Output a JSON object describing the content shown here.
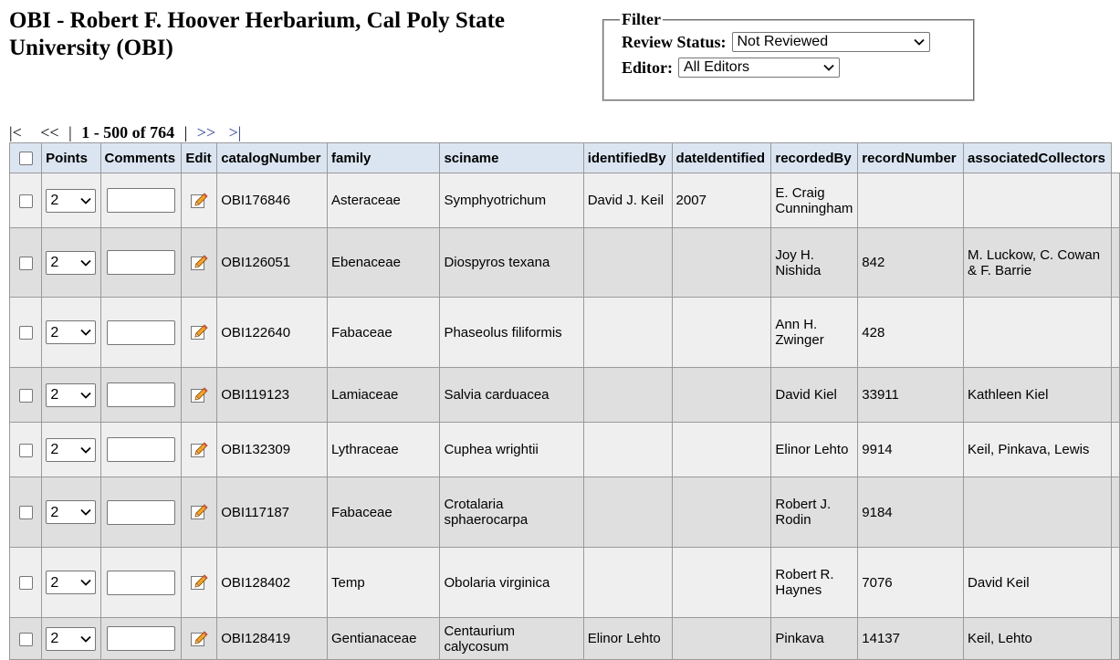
{
  "header": {
    "title": "OBI - Robert F. Hoover Herbarium, Cal Poly State University (OBI)"
  },
  "filter": {
    "legend": "Filter",
    "review_status_label": "Review Status:",
    "review_status_value": "Not Reviewed",
    "editor_label": "Editor:",
    "editor_value": "All Editors"
  },
  "pager": {
    "first": "|<",
    "prev": "<<",
    "sep": "|",
    "range": "1 - 500 of 764",
    "next": ">>",
    "last": ">|"
  },
  "table": {
    "columns": [
      "Points",
      "Comments",
      "Edit",
      "catalogNumber",
      "family",
      "sciname",
      "identifiedBy",
      "dateIdentified",
      "recordedBy",
      "recordNumber",
      "associatedCollectors"
    ],
    "rows": [
      {
        "points": "2",
        "catalogNumber": "OBI176846",
        "family": "Asteraceae",
        "sciname": "Symphyotrichum",
        "identifiedBy": "David J. Keil",
        "dateIdentified": "2007",
        "recordedBy": "E. Craig Cunningham",
        "recordNumber": "",
        "associatedCollectors": ""
      },
      {
        "points": "2",
        "catalogNumber": "OBI126051",
        "family": "Ebenaceae",
        "sciname": "Diospyros texana",
        "identifiedBy": "",
        "dateIdentified": "",
        "recordedBy": "Joy H. Nishida",
        "recordNumber": "842",
        "associatedCollectors": "M. Luckow, C. Cowan & F. Barrie"
      },
      {
        "points": "2",
        "catalogNumber": "OBI122640",
        "family": "Fabaceae",
        "sciname": "Phaseolus filiformis",
        "identifiedBy": "",
        "dateIdentified": "",
        "recordedBy": "Ann H. Zwinger",
        "recordNumber": "428",
        "associatedCollectors": ""
      },
      {
        "points": "2",
        "catalogNumber": "OBI119123",
        "family": "Lamiaceae",
        "sciname": "Salvia carduacea",
        "identifiedBy": "",
        "dateIdentified": "",
        "recordedBy": "David Kiel",
        "recordNumber": "33911",
        "associatedCollectors": "Kathleen Kiel"
      },
      {
        "points": "2",
        "catalogNumber": "OBI132309",
        "family": "Lythraceae",
        "sciname": "Cuphea wrightii",
        "identifiedBy": "",
        "dateIdentified": "",
        "recordedBy": "Elinor Lehto",
        "recordNumber": "9914",
        "associatedCollectors": "Keil, Pinkava, Lewis"
      },
      {
        "points": "2",
        "catalogNumber": "OBI117187",
        "family": "Fabaceae",
        "sciname": "Crotalaria sphaerocarpa",
        "identifiedBy": "",
        "dateIdentified": "",
        "recordedBy": "Robert J. Rodin",
        "recordNumber": "9184",
        "associatedCollectors": ""
      },
      {
        "points": "2",
        "catalogNumber": "OBI128402",
        "family": "Temp",
        "sciname": "Obolaria virginica",
        "identifiedBy": "",
        "dateIdentified": "",
        "recordedBy": "Robert R. Haynes",
        "recordNumber": "7076",
        "associatedCollectors": "David Keil"
      },
      {
        "points": "2",
        "catalogNumber": "OBI128419",
        "family": "Gentianaceae",
        "sciname": "Centaurium calycosum",
        "identifiedBy": "Elinor Lehto",
        "dateIdentified": "",
        "recordedBy": "Pinkava",
        "recordNumber": "14137",
        "associatedCollectors": "Keil, Lehto"
      }
    ]
  },
  "icons": {
    "chevron": "chevron-down-icon",
    "edit": "pencil-icon"
  },
  "colors": {
    "header_bg": "#dbe5f1",
    "row_odd": "#efefef",
    "row_even": "#dfdfdf",
    "link": "#2a3d8f"
  }
}
